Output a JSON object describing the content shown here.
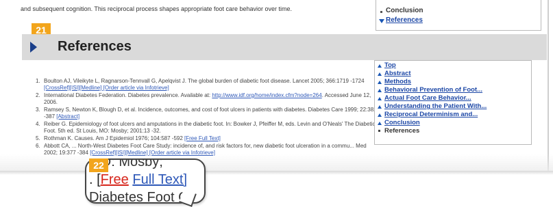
{
  "intro_text": "and subsequent cognition. This reciprocal process shapes appropriate foot care behavior over time.",
  "nav_top": {
    "items": [
      "Conclusion",
      "References"
    ]
  },
  "badges": {
    "b21": "21",
    "b22": "22"
  },
  "section": {
    "title": "References"
  },
  "references": [
    {
      "num": "1.",
      "text": "Boulton AJ, Vileikyte L, Ragnarson-Tennvall G, Apelqvist J. The global burden of diabetic foot disease. Lancet 2005; 366:1719 -1724",
      "links": "[CrossRef][ISI][Medline] [Order article via Infotrieve]"
    },
    {
      "num": "2.",
      "text": "International Diabetes Federation. Diabetes prevalence. Available at:",
      "links": "http://www.idf.org/home/index.cfm?node=264",
      "after": ". Accessed June 12, 2006."
    },
    {
      "num": "3.",
      "text": "Ramsey S, Newton K, Blough D, et al. Incidence, outcomes, and cost of foot ulcers in patients with diabetes. Diabetes Care 1999; 22:382 -387",
      "links": "[Abstract]"
    },
    {
      "num": "4.",
      "text": "Reiber G. Epidemiology of foot ulcers and amputations in the diabetic foot. In: Bowker J, Pfeiffer M, eds. Levin and O'Neals' The Diabetic Foot. 5th ed. St Louis, MO: Mosby; 2001:13 -32."
    },
    {
      "num": "5.",
      "text": "Rothman K. Causes. Am J Epidemiol 1976; 104:587 -592",
      "links": "[Free Full Text]"
    },
    {
      "num": "6.",
      "text": "Abbott CA, ... North-West Diabetes Foot Care Study: incidence of, and risk factors for, new diabetic foot ulceration in a commu... Med 2002; 19:377 -384",
      "links": "[CrossRef][ISI][Medline] [Order article via Infotrieve]"
    }
  ],
  "sidebar": {
    "items": [
      "Top",
      "Abstract",
      "Methods",
      "Behavioral Prevention of Foot...",
      "Actual Foot Care Behavior...",
      "Understanding the Patient With...",
      "Reciprocal Determinism and...",
      "Conclusion",
      "References"
    ]
  },
  "magnifier": {
    "line1": "MO: Mosby;",
    "free": "Free",
    "full_text": "Full Text]",
    "line3": "Diabetes Foot C"
  }
}
